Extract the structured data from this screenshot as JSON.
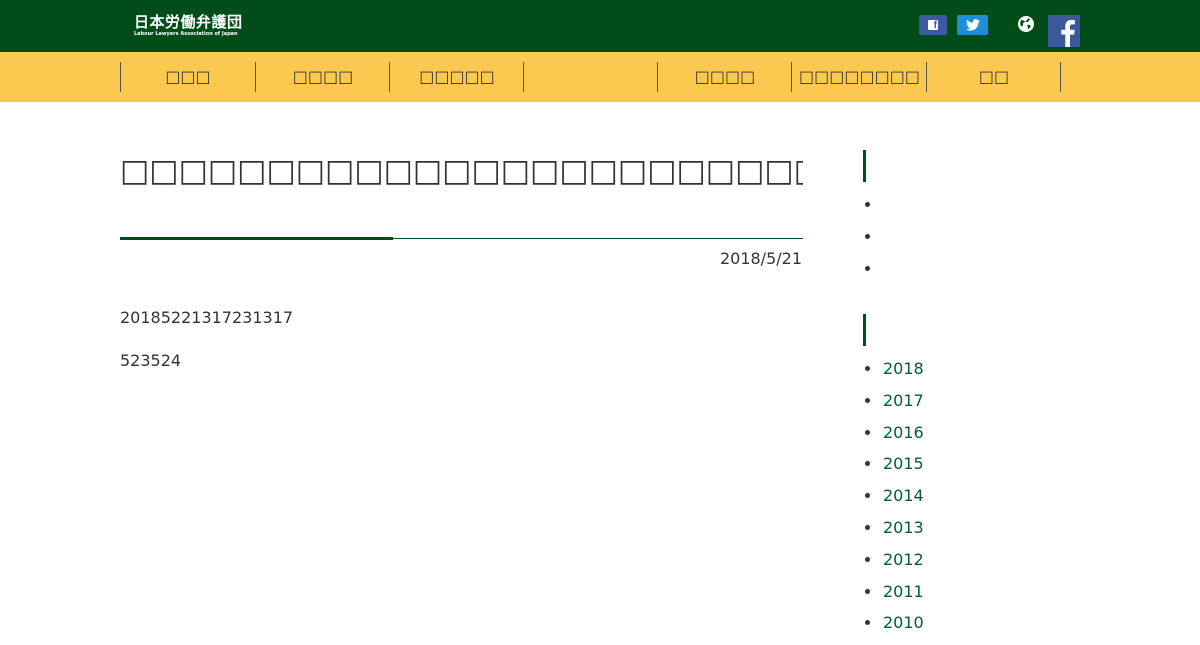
{
  "header": {
    "logo": {
      "main": "日本労働弁護団",
      "sub": "Labour Lawyers Association of Japan"
    },
    "icons": {
      "facebook_share": "facebook-square-icon",
      "twitter_share": "twitter-bird-icon",
      "language": "globe-icon",
      "facebook_page": "facebook-logo-icon"
    },
    "colors": {
      "topbar": "#004d1a",
      "navbar": "#fbc94f",
      "link": "#00602a",
      "facebook": "#3b5998",
      "twitter": "#1d8fd6"
    }
  },
  "nav": {
    "items": [
      {
        "label": "□□□"
      },
      {
        "label": "□□□□"
      },
      {
        "label": "□□□□□"
      },
      {
        "label": ""
      },
      {
        "label": "□□□□"
      },
      {
        "label": "□□□□□□□□"
      },
      {
        "label": "□□"
      }
    ]
  },
  "article": {
    "title": "□□□□□□□□□□□□□□□□□□□□□□□□□□□□□□□□□□□□□□□",
    "date": "2018/5/21",
    "paragraphs": [
      "20185221317231317",
      "523524"
    ]
  },
  "sidebar": {
    "recent_items": [
      "",
      "",
      ""
    ],
    "archive_years": [
      "2018",
      "2017",
      "2016",
      "2015",
      "2014",
      "2013",
      "2012",
      "2011",
      "2010"
    ]
  }
}
